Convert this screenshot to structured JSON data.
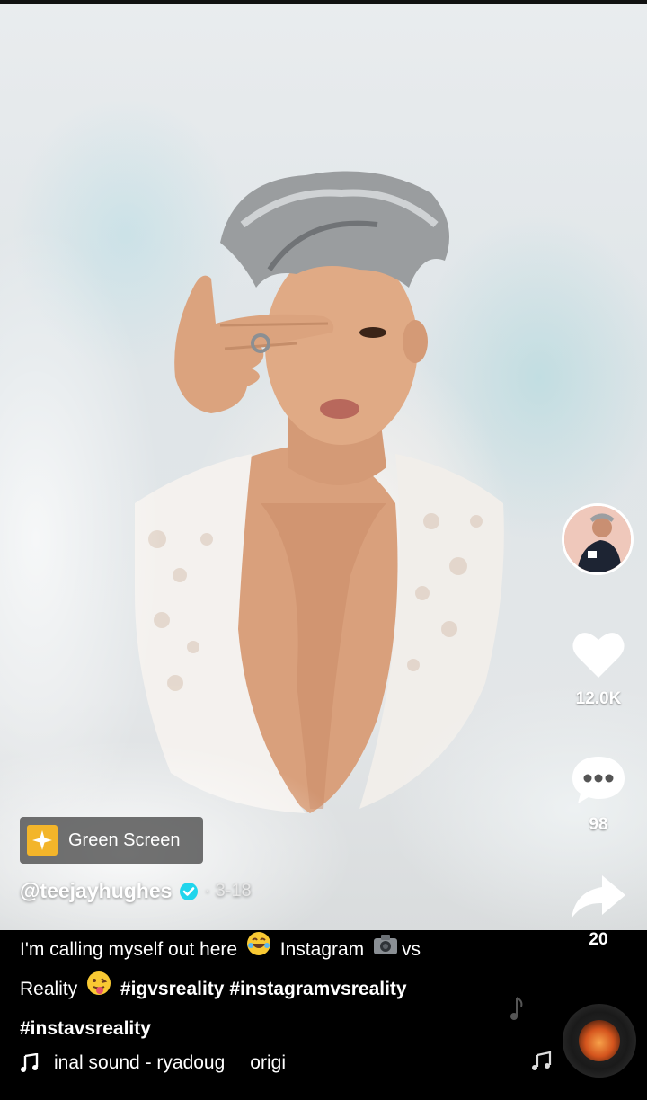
{
  "video": {
    "description_colors": {
      "accent": "#20d5ec",
      "effect": "#f3b52a"
    }
  },
  "effect": {
    "label": "Green Screen",
    "icon": "sparkle-icon"
  },
  "author": {
    "handle": "@teejayhughes",
    "date": "· 3-18",
    "verified": true
  },
  "actions": {
    "likes": "12.0K",
    "comments": "98",
    "shares": "20"
  },
  "caption": {
    "line1_text_a": "I'm calling myself out here",
    "line1_text_b": "Instagram",
    "line1_text_c": "vs",
    "line2_text_a": "Reality",
    "tag1": "#igvsreality",
    "tag2": "#instagramvsreality",
    "tag3": "#instavsreality"
  },
  "sound": {
    "text": "inal sound - ryadoug",
    "text_trailing": "origi"
  }
}
